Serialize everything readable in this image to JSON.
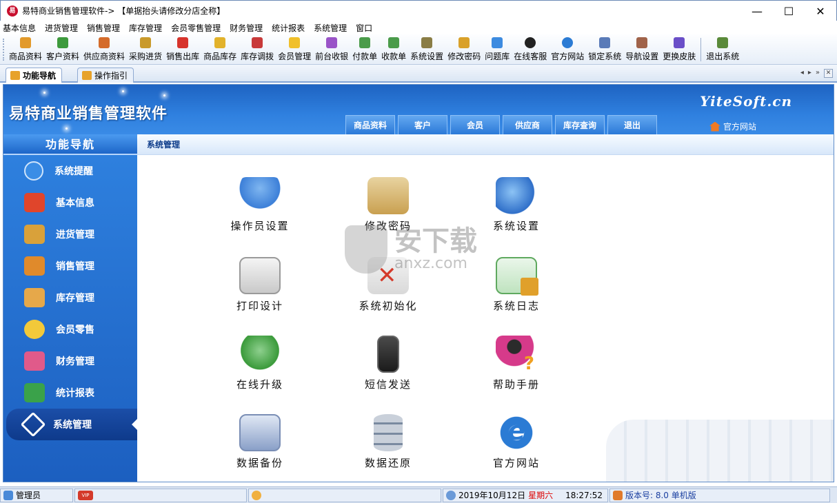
{
  "window": {
    "title": "易特商业销售管理软件-> 【单据抬头请修改分店全称】",
    "controls": {
      "minimize": "—",
      "maximize": "☐",
      "close": "✕"
    }
  },
  "menu": [
    "基本信息",
    "进货管理",
    "销售管理",
    "库存管理",
    "会员零售管理",
    "财务管理",
    "统计报表",
    "系统管理",
    "窗口"
  ],
  "toolbar": [
    {
      "label": "商品资料",
      "icon": "box-icon",
      "color": "#e29a2b"
    },
    {
      "label": "客户资料",
      "icon": "users-icon",
      "color": "#3d9a3d"
    },
    {
      "label": "供应商资料",
      "icon": "supplier-icon",
      "color": "#d46b2a"
    },
    {
      "label": "采购进货",
      "icon": "truck-icon",
      "color": "#c99a2b"
    },
    {
      "label": "销售出库",
      "icon": "basket-icon",
      "color": "#d7342c"
    },
    {
      "label": "商品库存",
      "icon": "stock-icon",
      "color": "#e2b22b"
    },
    {
      "label": "库存调拨",
      "icon": "transfer-icon",
      "color": "#c83a3a"
    },
    {
      "label": "会员管理",
      "icon": "member-icon",
      "color": "#f0c02b"
    },
    {
      "label": "前台收银",
      "icon": "cashier-icon",
      "color": "#9a54c8"
    },
    {
      "label": "付款单",
      "icon": "payment-icon",
      "color": "#4a9b4a"
    },
    {
      "label": "收款单",
      "icon": "receipt-icon",
      "color": "#4a9b4a"
    },
    {
      "label": "系统设置",
      "icon": "settings-icon",
      "color": "#8a7d45"
    },
    {
      "label": "修改密码",
      "icon": "pencil-icon",
      "color": "#d9a12a"
    },
    {
      "label": "问题库",
      "icon": "question-icon",
      "color": "#3d8be0"
    },
    {
      "label": "在线客服",
      "icon": "chat-icon",
      "color": "#222222"
    },
    {
      "label": "官方网站",
      "icon": "ie-icon",
      "color": "#2b7bd4"
    },
    {
      "label": "锁定系统",
      "icon": "lock-icon",
      "color": "#5a7bb8"
    },
    {
      "label": "导航设置",
      "icon": "nav-icon",
      "color": "#a0634a"
    },
    {
      "label": "更换皮肤",
      "icon": "skin-icon",
      "color": "#6a4fc8"
    },
    {
      "label": "退出系统",
      "icon": "exit-icon",
      "color": "#5a8a3a"
    }
  ],
  "tabs": [
    {
      "label": "功能导航",
      "active": true
    },
    {
      "label": "操作指引",
      "active": false
    }
  ],
  "tab_nav": {
    "prev": "◂",
    "next": "▸",
    "more": "»",
    "close": "✕"
  },
  "banner": {
    "app_title": "易特商业销售管理软件",
    "brand": "YiteSoft.cn",
    "top_tabs": [
      "商品资料",
      "客户",
      "会员",
      "供应商",
      "库存查询",
      "退出"
    ],
    "official_link": "官方网站"
  },
  "sidebar": {
    "header": "功能导航",
    "items": [
      {
        "label": "系统提醒",
        "icon": "info-icon",
        "color": "#3a8de6"
      },
      {
        "label": "基本信息",
        "icon": "cubes-icon",
        "color": "#e0452b"
      },
      {
        "label": "进货管理",
        "icon": "box-in-icon",
        "color": "#d9a13a"
      },
      {
        "label": "销售管理",
        "icon": "box-out-icon",
        "color": "#e08a2b"
      },
      {
        "label": "库存管理",
        "icon": "warehouse-icon",
        "color": "#e6a84a"
      },
      {
        "label": "会员零售",
        "icon": "balloon-icon",
        "color": "#f2c93a"
      },
      {
        "label": "财务管理",
        "icon": "finance-icon",
        "color": "#e05a8a"
      },
      {
        "label": "统计报表",
        "icon": "bar-chart-icon",
        "color": "#3aa24a"
      },
      {
        "label": "系统管理",
        "icon": "tools-icon",
        "color": "#ffffff",
        "active": true
      }
    ]
  },
  "content": {
    "header": "系统管理",
    "items": [
      {
        "label": "操作员设置",
        "icon": "operator-icon",
        "color": "#3c7fd8"
      },
      {
        "label": "修改密码",
        "icon": "password-icon",
        "color": "#c9a050"
      },
      {
        "label": "系统设置",
        "icon": "system-settings-icon",
        "color": "#2f6fc9"
      },
      {
        "label": "打印设计",
        "icon": "printer-icon",
        "color": "#c9c9c9"
      },
      {
        "label": "系统初始化",
        "icon": "init-icon",
        "color": "#d43a2b"
      },
      {
        "label": "系统日志",
        "icon": "log-icon",
        "color": "#e0a02b"
      },
      {
        "label": "在线升级",
        "icon": "upgrade-icon",
        "color": "#3a9a3a"
      },
      {
        "label": "短信发送",
        "icon": "phone-icon",
        "color": "#2b2b2b"
      },
      {
        "label": "帮助手册",
        "icon": "help-icon",
        "color": "#d63a8a"
      },
      {
        "label": "数据备份",
        "icon": "backup-icon",
        "color": "#8aa0c8"
      },
      {
        "label": "数据还原",
        "icon": "restore-icon",
        "color": "#7a8aa0"
      },
      {
        "label": "官方网站",
        "icon": "website-ie-icon",
        "color": "#2b7bd4"
      }
    ]
  },
  "watermark": {
    "text": "安下载",
    "sub": "anxz.com"
  },
  "status": {
    "user": "管理员",
    "vip": "VIP",
    "date": "2019年10月12日",
    "weekday": "星期六",
    "time": "18:27:52",
    "version": "版本号: 8.0 单机版"
  }
}
